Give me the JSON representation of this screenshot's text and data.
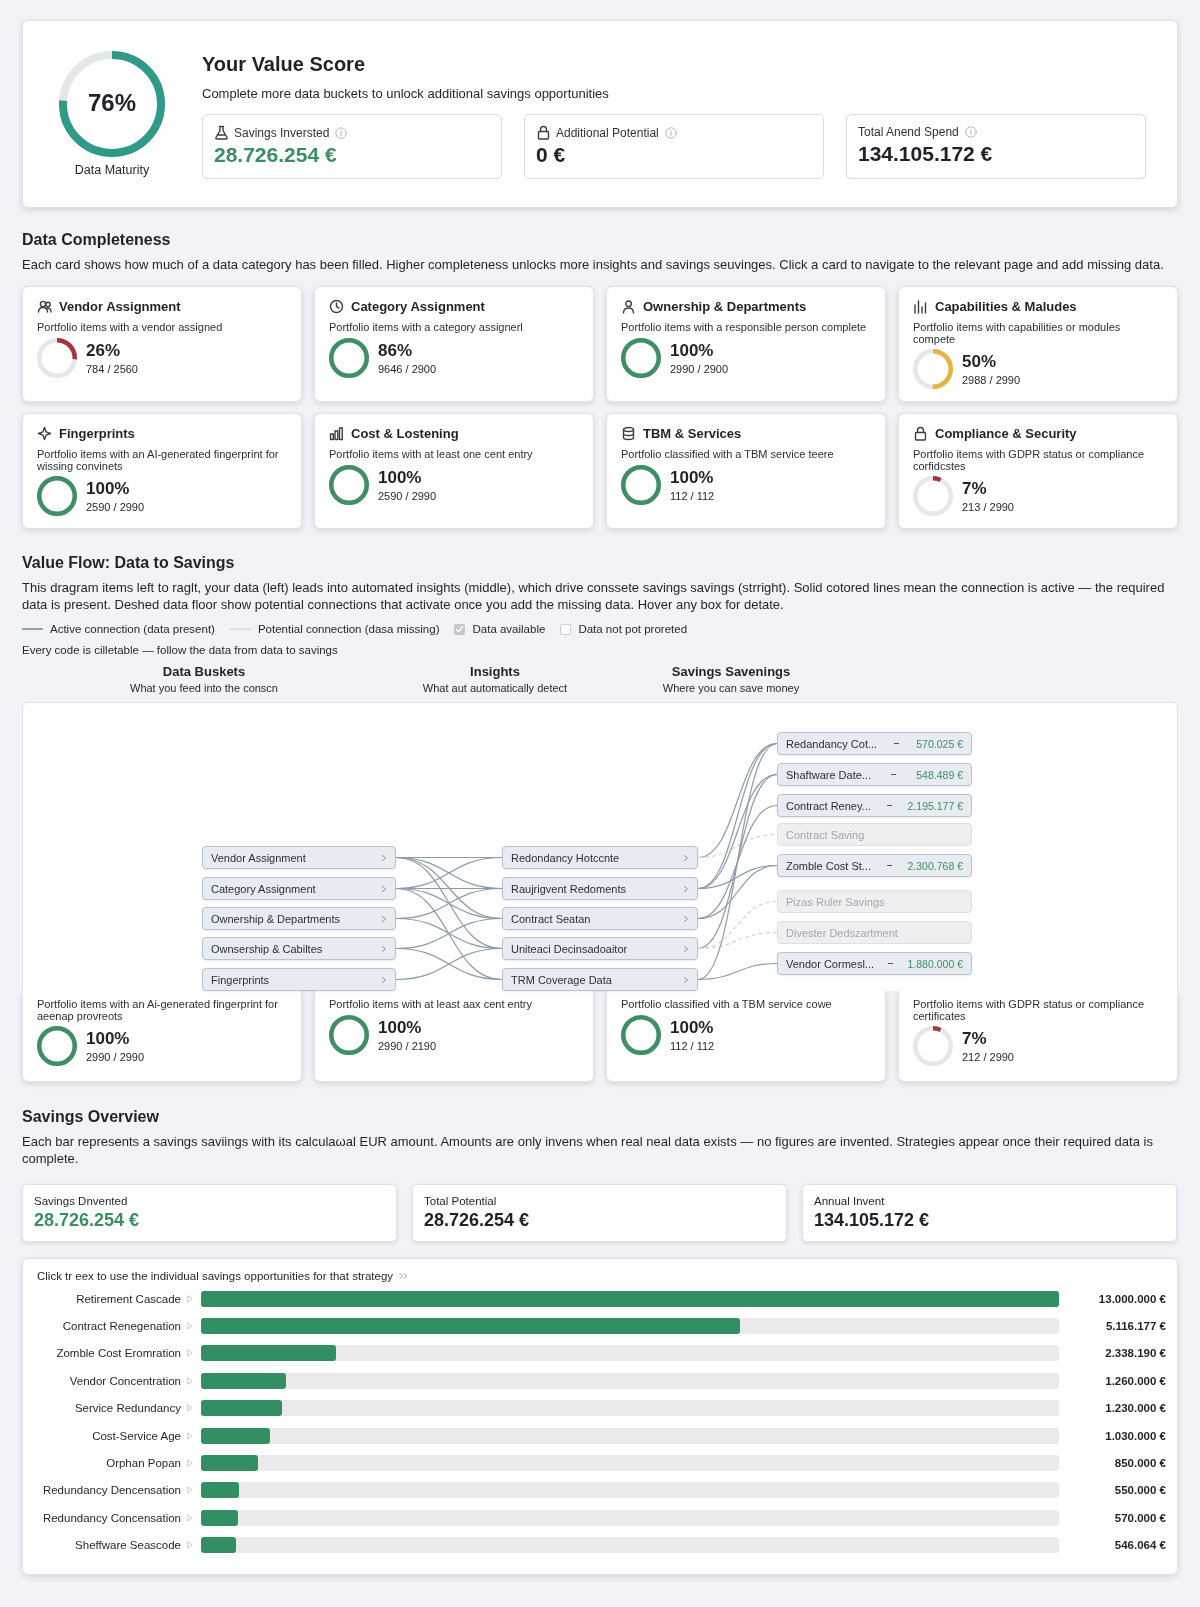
{
  "value_score": {
    "maturity": {
      "percent": "76%",
      "label": "Data Maturity"
    },
    "title": "Your Value Score",
    "subtitle": "Complete more data buckets to unlock additional savings opportunities",
    "stats": [
      {
        "label": "Savings Inversted",
        "value": "28.726.254 €",
        "highlight": true
      },
      {
        "label": "Additional Potential",
        "value": "0 €",
        "highlight": false
      },
      {
        "label": "Total Anend Spend",
        "value": "134.105.172 €",
        "highlight": false
      }
    ]
  },
  "data_completeness": {
    "title": "Data Completeness",
    "description": "Each card shows how much of a data category has been filled. Higher completeness unlocks more insights and savings seuvinges. Click a card to navigate to the relevant page and add missing data.",
    "cards": [
      {
        "title": "Vendor Assignment",
        "description": "Portfolio items with a vendor assigned",
        "percent": "26%",
        "count": "784 / 2560",
        "color": "#a8343c"
      },
      {
        "title": "Category Assignment",
        "description": "Portfolio items with a category assignerl",
        "percent": "86%",
        "count": "9646 / 2900",
        "color": "#3f8f64"
      },
      {
        "title": "Ownership & Departments",
        "description": "Portfolio items with a responsible person complete",
        "percent": "100%",
        "count": "2990 / 2900",
        "color": "#3f8f64"
      },
      {
        "title": "Capabilities & Maludes",
        "description": "Portfolio items with capabilities or modules compete",
        "percent": "50%",
        "count": "2988 / 2990",
        "color": "#e6b43c"
      },
      {
        "title": "Fingerprints",
        "description": "Portfolio items with an AI-generated fingerprint for wissing convinets",
        "percent": "100%",
        "count": "2590 / 2990",
        "color": "#3f8f64"
      },
      {
        "title": "Cost & Lostening",
        "description": "Portfolio items with at least one cent entry",
        "percent": "100%",
        "count": "2590 / 2990",
        "color": "#3f8f64"
      },
      {
        "title": "TBM & Services",
        "description": "Portfolio classified with a TBM service teere",
        "percent": "100%",
        "count": "112 / 112",
        "color": "#3f8f64"
      },
      {
        "title": "Compliance & Security",
        "description": "Portfolio items with GDPR status or compliance corfidcstes",
        "percent": "7%",
        "count": "213 / 2990",
        "color": "#a8343c"
      }
    ]
  },
  "value_flow": {
    "title": "Value Flow: Data to Savings",
    "description": "This dragram items left to raglt, your data (left)  leads into automated insights (middle), which drive conssete savings savings (strright). Solid cotored lines mean the connection is active — the required data is present. Deshed data floor show potential connections that activate once you add the missing data. Hover any box for detate.",
    "legend": [
      {
        "kind": "active-line",
        "label": "Active connection (data present)"
      },
      {
        "kind": "potential-line",
        "label": "Potential connection (dasa missing)"
      },
      {
        "kind": "checkbox",
        "label": "Data available",
        "checked": true
      },
      {
        "kind": "checkbox",
        "label": "Data not pot proreted",
        "checked": false
      }
    ],
    "hint": "Every code is cilletable — follow the data from data to savings",
    "columns": [
      {
        "title": "Data Buskets",
        "subtitle": "What you feed into the conscn"
      },
      {
        "title": "Insights",
        "subtitle": "What aut automatically detect"
      },
      {
        "title": "Savings Savenings",
        "subtitle": "Where you can save money"
      }
    ],
    "data_nodes": [
      {
        "label": "Vendor Assignment"
      },
      {
        "label": "Category Assignment"
      },
      {
        "label": "Ownership & Departments"
      },
      {
        "label": "Ownsership & Cabiltes"
      },
      {
        "label": "Fingerprints"
      }
    ],
    "insight_nodes": [
      {
        "label": "Redondancy Hotccnte"
      },
      {
        "label": "Raujrigvent Redoments"
      },
      {
        "label": "Contract Seatan"
      },
      {
        "label": "Uniteaci Decinsadoaitor"
      },
      {
        "label": "TRM Coverage Data"
      }
    ],
    "savings_nodes": [
      {
        "label": "Redandancy Cot...",
        "amount": "570.025 €",
        "active": true
      },
      {
        "label": "Shaftware Date...",
        "amount": "548.489 €",
        "active": true
      },
      {
        "label": "Contract Reney...",
        "amount": "2.195.177 €",
        "active": true
      },
      {
        "label": "Contract Saving",
        "active": false
      },
      {
        "label": "Zomble Cost St...",
        "amount": "2.300.768 €",
        "active": true
      },
      {
        "label": "Pizas Ruler Savings",
        "active": false
      },
      {
        "label": "Divester Dedszartment",
        "active": false
      },
      {
        "label": "Vendor Cormesl...",
        "amount": "1.880.000 €",
        "active": true
      }
    ],
    "lower_cards": [
      {
        "description": "Portfolio items with an Ai-generated fingerprint for aeenap provreots",
        "percent": "100%",
        "count": "2990 / 2990",
        "color": "#3f8f64"
      },
      {
        "description": "Portfolio items with at least aax cent entry",
        "percent": "100%",
        "count": "2990 / 2190",
        "color": "#3f8f64"
      },
      {
        "description": "Portfolio classified vith a TBM service cowe",
        "percent": "100%",
        "count": "112 / 112",
        "color": "#3f8f64"
      },
      {
        "description": "Portfolio items with GDPR status or compliance certificates",
        "percent": "7%",
        "count": "212 / 2990",
        "color": "#a8343c"
      }
    ]
  },
  "savings_overview": {
    "title": "Savings Overview",
    "description": "Each bar represents a savings saviings with its calculaωal EUR amount. Amounts are only invens when real neal data exists — no figures are invented. Strategies appear once their required data is complete.",
    "stats": [
      {
        "label": "Savings Dnvented",
        "value": "28.726.254 €",
        "highlight": true
      },
      {
        "label": "Total Potential",
        "value": "28.726.254 €",
        "highlight": false
      },
      {
        "label": "Annual Invent",
        "value": "134.105.172 €",
        "highlight": false
      }
    ],
    "hint": "Click tr eex to use the individual savings opportunities for that strategy",
    "bars": [
      {
        "label": "Retirement Cascade",
        "amount": "13.000.000 €",
        "level": 1
      },
      {
        "label": "Contract Renegenation",
        "amount": "5.116.177 €",
        "level": 0.628
      },
      {
        "label": "Zomble Cost Eromration",
        "amount": "2.338.190 €",
        "level": 0.157
      },
      {
        "label": "Vendor Concentration",
        "amount": "1.260.000 €",
        "level": 0.099
      },
      {
        "label": "Service Redundancy",
        "amount": "1.230.000 €",
        "level": 0.094
      },
      {
        "label": "Cost-Service Age",
        "amount": "1.030.000 €",
        "level": 0.08
      },
      {
        "label": "Orphan Popan",
        "amount": "850.000 €",
        "level": 0.066
      },
      {
        "label": "Redundancy Dencensation",
        "amount": "550.000 €",
        "level": 0.044
      },
      {
        "label": "Redundancy Concensation",
        "amount": "570.000 €",
        "level": 0.043
      },
      {
        "label": "Sheffware Seascode",
        "amount": "546.064 €",
        "level": 0.041
      }
    ]
  }
}
